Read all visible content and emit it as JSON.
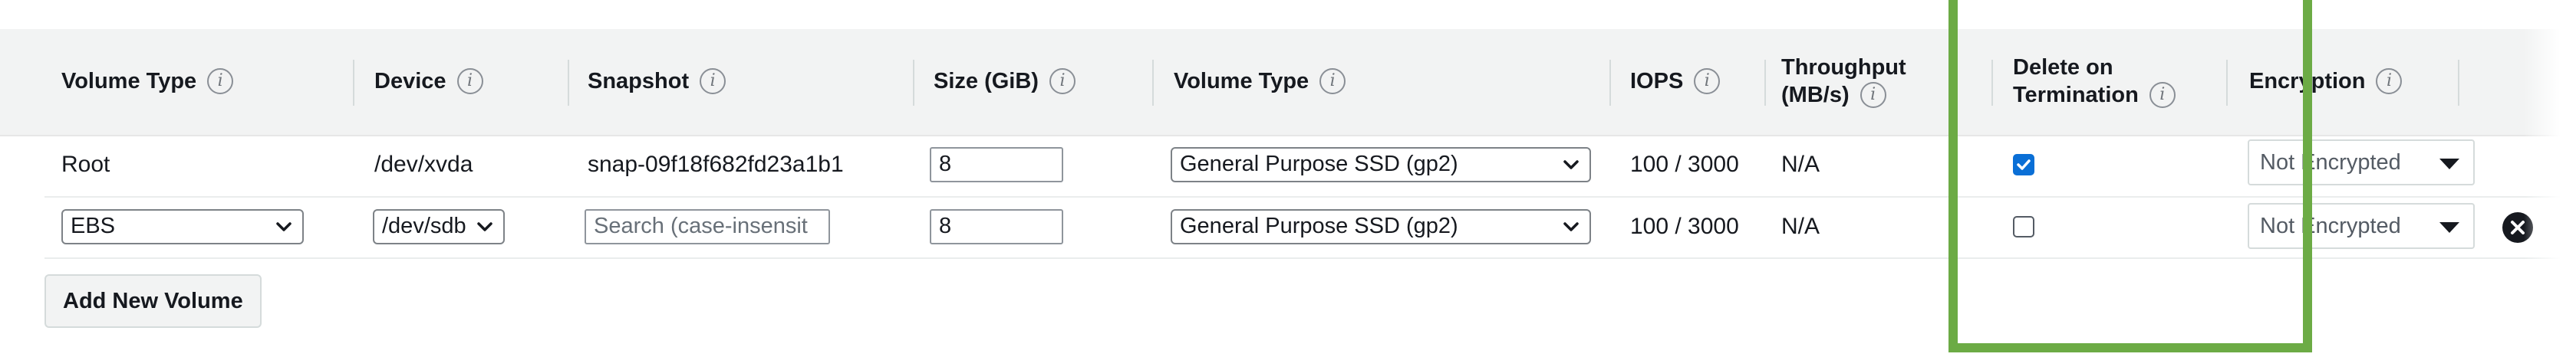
{
  "headers": {
    "volume_type": "Volume Type",
    "device": "Device",
    "snapshot": "Snapshot",
    "size": "Size (GiB)",
    "volume_type_2": "Volume Type",
    "iops": "IOPS",
    "throughput_line1": "Throughput",
    "throughput_line2": "(MB/s)",
    "delete_line1": "Delete on",
    "delete_line2": "Termination",
    "encryption": "Encryption"
  },
  "info_glyph": "i",
  "rows": [
    {
      "volume_type": "Root",
      "device": "/dev/xvda",
      "snapshot": "snap-09f18f682fd23a1b1",
      "size": "8",
      "ebs_volume_type": "General Purpose SSD (gp2)",
      "iops": "100 / 3000",
      "throughput": "N/A",
      "delete_on_termination": true,
      "encryption": "Not Encrypted"
    },
    {
      "volume_type": "EBS",
      "device": "/dev/sdb",
      "snapshot_placeholder": "Search (case-insensit",
      "size": "8",
      "ebs_volume_type": "General Purpose SSD (gp2)",
      "iops": "100 / 3000",
      "throughput": "N/A",
      "delete_on_termination": false,
      "encryption": "Not Encrypted"
    }
  ],
  "add_button_label": "Add New Volume",
  "icons": {
    "info": "info-icon",
    "chevron": "chevron-down-icon",
    "caret": "caret-down-icon",
    "remove": "remove-circle-icon",
    "check": "checkmark-icon"
  },
  "colors": {
    "highlight_border": "#6cab45",
    "checkbox_checked": "#0a6fd6",
    "header_background": "#f2f3f3"
  }
}
